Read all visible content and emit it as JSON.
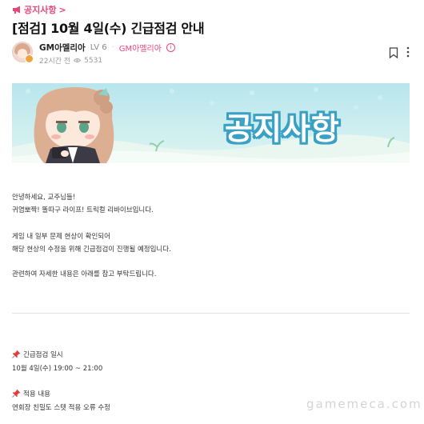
{
  "breadcrumb": {
    "label": "공지사항",
    "arrow": ">"
  },
  "post": {
    "title": "[점검] 10월 4일(수) 긴급점검 안내",
    "author": "GM아멜리아",
    "level": "LV 6",
    "separator": "·",
    "author_tag": "GM아멜리아",
    "info_glyph": "i",
    "time": "22시간 전",
    "views": "5531"
  },
  "banner": {
    "text": "공지사항"
  },
  "content": {
    "p1": "안녕하세요, 교주님들!",
    "p2": "귀염뽀짝! 똘따구 라이프! 트릭컬 리바이브입니다.",
    "p3": "게임 내 일부 문제 현상이 확인되어",
    "p4": "해당 현상의 수정을 위해 긴급점검이 진행될 예정입니다.",
    "p5": "관련하여 자세한 내용은 아래를 참고 부탁드립니다.",
    "s1_title": "긴급점검 일시",
    "s1_body": "10월 4일(수) 19:00 ~ 21:00",
    "s2_title": "적용 내용",
    "s2_body": "연회장 친밀도 스텟 적용 오류 수정"
  },
  "watermark": "gamemeca.com",
  "icons": {
    "megaphone": "megaphone-icon",
    "bookmark": "bookmark-icon",
    "more": "more-vertical-icon",
    "eye": "eye-icon",
    "pin": "pushpin-icon"
  },
  "colors": {
    "accent": "#e8467a",
    "banner_sky": "#c7ecef",
    "banner_text_outline": "#3aa0c4"
  }
}
